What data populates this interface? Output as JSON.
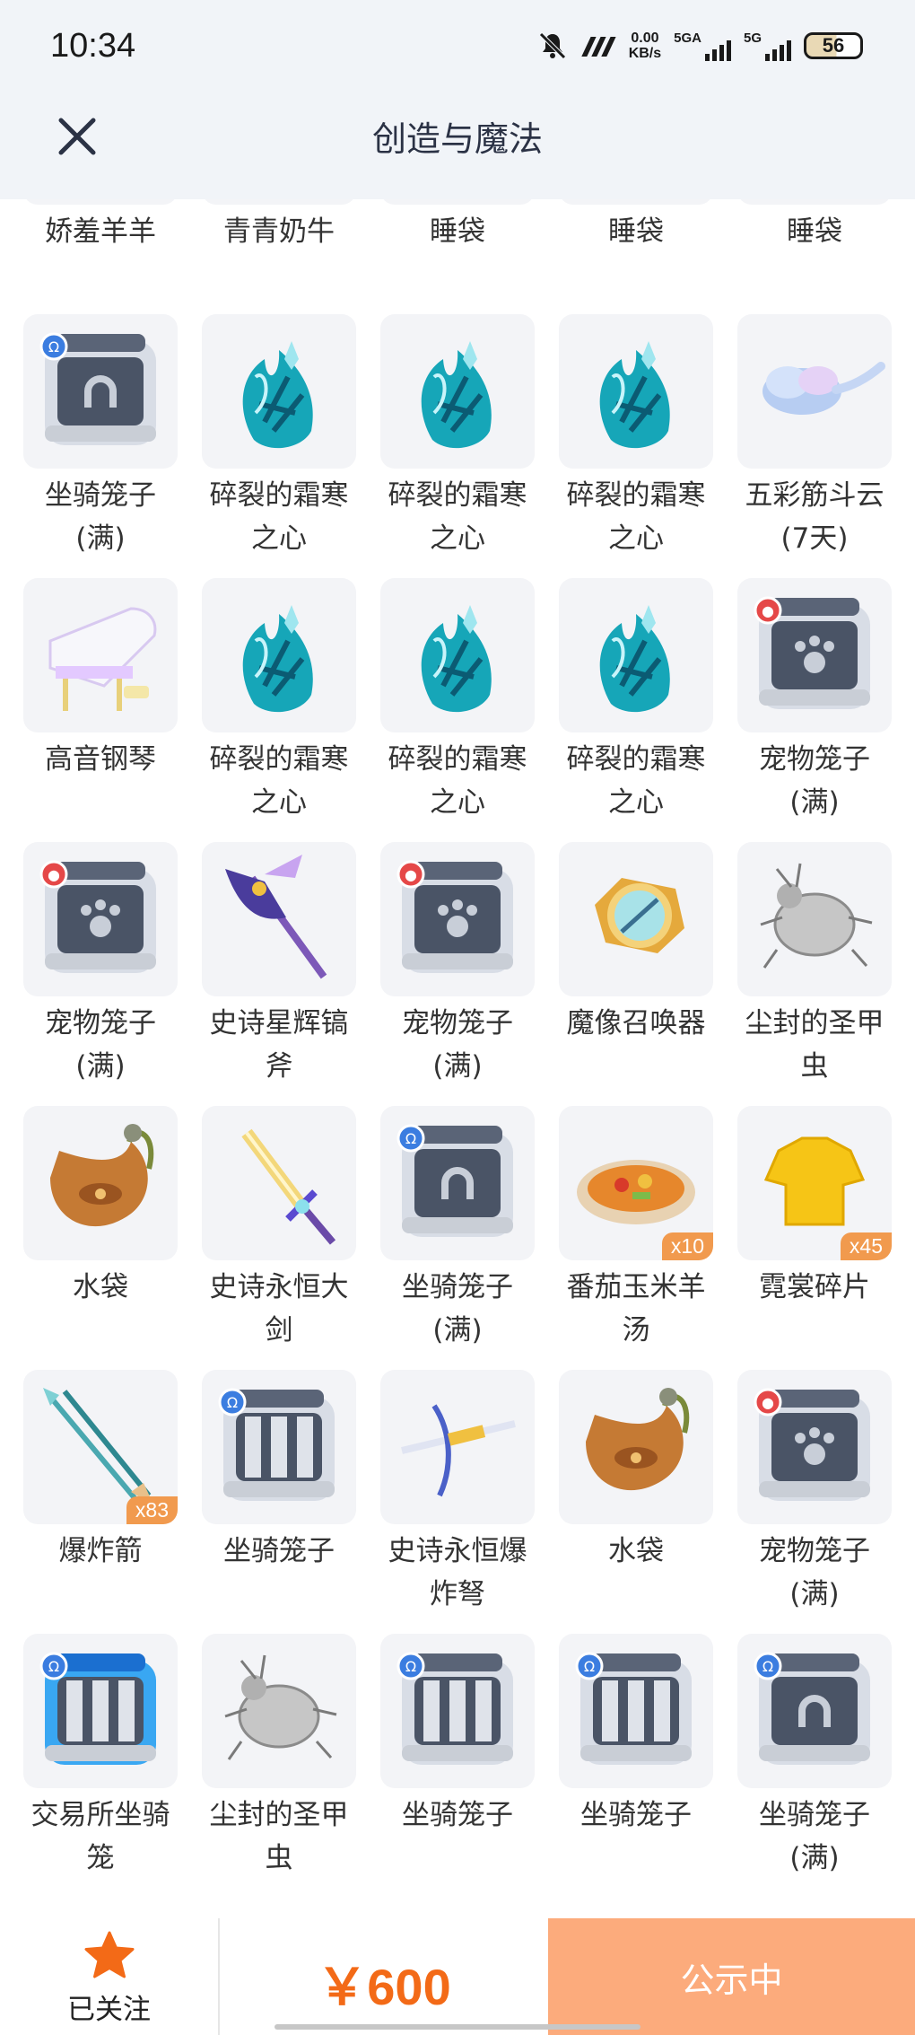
{
  "statusbar": {
    "time": "10:34",
    "speed_value": "0.00",
    "speed_unit": "KB/s",
    "signal_1": "5GA",
    "signal_2": "5G",
    "battery": "56"
  },
  "header": {
    "title": "创造与魔法"
  },
  "items": [
    {
      "name": "娇羞羊羊",
      "type": "sheep"
    },
    {
      "name": "青青奶牛",
      "type": "cow"
    },
    {
      "name": "睡袋",
      "type": "bag"
    },
    {
      "name": "睡袋",
      "type": "bag"
    },
    {
      "name": "睡袋",
      "type": "bag"
    },
    {
      "name": "坐骑笼子\n(满)",
      "type": "cage-mount-full"
    },
    {
      "name": "碎裂的霜寒\n之心",
      "type": "frost"
    },
    {
      "name": "碎裂的霜寒\n之心",
      "type": "frost"
    },
    {
      "name": "碎裂的霜寒\n之心",
      "type": "frost"
    },
    {
      "name": "五彩筋斗云\n(7天)",
      "type": "cloud"
    },
    {
      "name": "高音钢琴",
      "type": "piano"
    },
    {
      "name": "碎裂的霜寒\n之心",
      "type": "frost"
    },
    {
      "name": "碎裂的霜寒\n之心",
      "type": "frost"
    },
    {
      "name": "碎裂的霜寒\n之心",
      "type": "frost"
    },
    {
      "name": "宠物笼子\n(满)",
      "type": "cage-pet"
    },
    {
      "name": "宠物笼子\n(满)",
      "type": "cage-pet"
    },
    {
      "name": "史诗星辉镐\n斧",
      "type": "axe"
    },
    {
      "name": "宠物笼子\n(满)",
      "type": "cage-pet"
    },
    {
      "name": "魔像召唤器",
      "type": "summoner"
    },
    {
      "name": "尘封的圣甲\n虫",
      "type": "beetle"
    },
    {
      "name": "水袋",
      "type": "waterbag"
    },
    {
      "name": "史诗永恒大\n剑",
      "type": "sword"
    },
    {
      "name": "坐骑笼子\n(满)",
      "type": "cage-mount-full"
    },
    {
      "name": "番茄玉米羊\n汤",
      "type": "soup",
      "count": "x10"
    },
    {
      "name": "霓裳碎片",
      "type": "shirt",
      "count": "x45"
    },
    {
      "name": "爆炸箭",
      "type": "arrow",
      "count": "x83"
    },
    {
      "name": "坐骑笼子",
      "type": "cage-mount"
    },
    {
      "name": "史诗永恒爆\n炸弩",
      "type": "crossbow"
    },
    {
      "name": "水袋",
      "type": "waterbag"
    },
    {
      "name": "宠物笼子\n(满)",
      "type": "cage-pet"
    },
    {
      "name": "交易所坐骑\n笼",
      "type": "cage-blue"
    },
    {
      "name": "尘封的圣甲\n虫",
      "type": "beetle"
    },
    {
      "name": "坐骑笼子",
      "type": "cage-mount"
    },
    {
      "name": "坐骑笼子",
      "type": "cage-mount"
    },
    {
      "name": "坐骑笼子\n(满)",
      "type": "cage-mount-full"
    }
  ],
  "footer": {
    "follow_label": "已关注",
    "follow_icon": "star-icon",
    "price": "￥600",
    "status_label": "公示中"
  },
  "colors": {
    "accent": "#f36a17",
    "status_button": "#fcab7c",
    "count_badge": "#f19a4e"
  }
}
